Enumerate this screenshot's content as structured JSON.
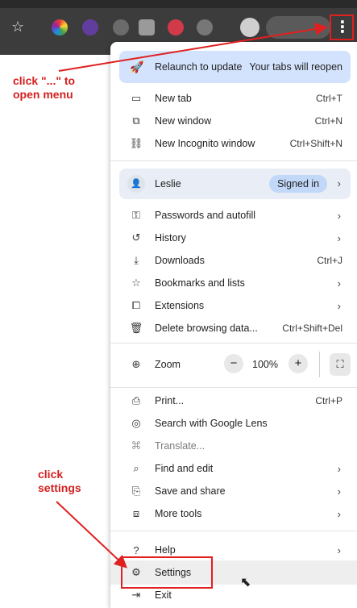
{
  "toolbar": {
    "star_icon": "star-icon",
    "menu_button_glyph": "⋮"
  },
  "menu": {
    "relaunch": {
      "label": "Relaunch to update",
      "note": "Your tabs will reopen"
    },
    "new_tab": {
      "label": "New tab",
      "shortcut": "Ctrl+T"
    },
    "new_window": {
      "label": "New window",
      "shortcut": "Ctrl+N"
    },
    "incognito": {
      "label": "New Incognito window",
      "shortcut": "Ctrl+Shift+N"
    },
    "profile": {
      "name": "Leslie",
      "status": "Signed in"
    },
    "passwords": {
      "label": "Passwords and autofill"
    },
    "history": {
      "label": "History"
    },
    "downloads": {
      "label": "Downloads",
      "shortcut": "Ctrl+J"
    },
    "bookmarks": {
      "label": "Bookmarks and lists"
    },
    "extensions": {
      "label": "Extensions"
    },
    "delete_data": {
      "label": "Delete browsing data...",
      "shortcut": "Ctrl+Shift+Del"
    },
    "zoom": {
      "label": "Zoom",
      "minus": "−",
      "value": "100%",
      "plus": "+"
    },
    "print": {
      "label": "Print...",
      "shortcut": "Ctrl+P"
    },
    "lens": {
      "label": "Search with Google Lens"
    },
    "translate": {
      "label": "Translate..."
    },
    "find": {
      "label": "Find and edit"
    },
    "save_share": {
      "label": "Save and share"
    },
    "more_tools": {
      "label": "More tools"
    },
    "help": {
      "label": "Help"
    },
    "settings": {
      "label": "Settings"
    },
    "exit": {
      "label": "Exit"
    }
  },
  "annotations": {
    "open_menu": "click \"...\" to open menu",
    "open_menu_line1": "click \"...\" to",
    "open_menu_line2": "open menu",
    "settings_line1": "click",
    "settings_line2": "settings"
  },
  "colors": {
    "annotation_red": "#e02020",
    "relaunch_bg": "#d3e3fd",
    "profile_bg": "#e9eef6",
    "toolbar_bg": "#3c3c3c"
  }
}
